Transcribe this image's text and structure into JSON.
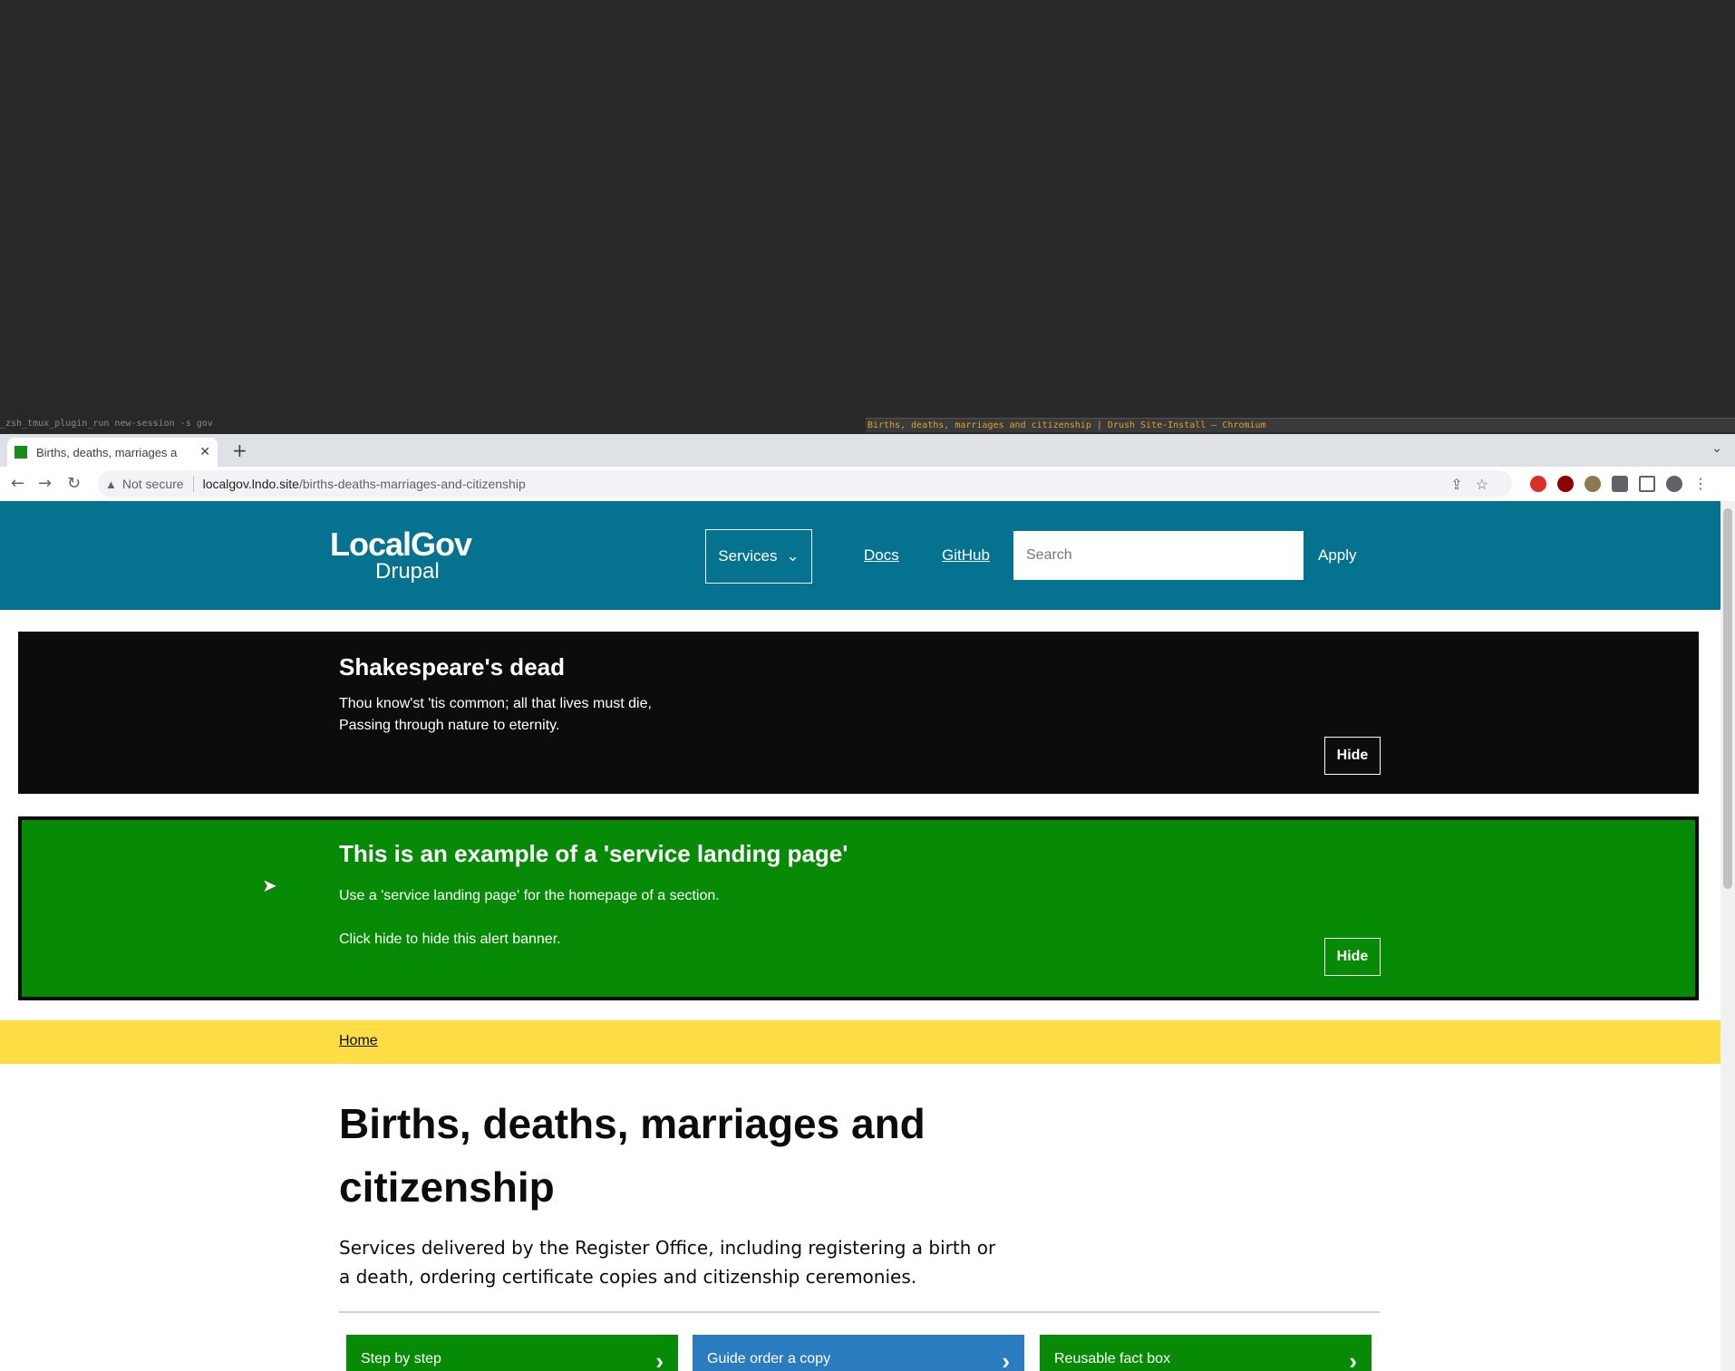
{
  "tmux": {
    "left_status": "_zsh_tmux_plugin_run new-session -s gov",
    "window_title": "Births, deaths, marriages and citizenship | Drush Site-Install – Chromium"
  },
  "browser": {
    "tab_title": "Births, deaths, marriages a",
    "security_label": "Not secure",
    "url_host": "localgov.lndo.site",
    "url_path": "/births-deaths-marriages-and-citizenship"
  },
  "header": {
    "logo_top": "LocalGov",
    "logo_bottom": "Drupal",
    "services_label": "Services",
    "docs_label": "Docs",
    "github_label": "GitHub",
    "search_placeholder": "Search",
    "apply_label": "Apply"
  },
  "alerts": [
    {
      "title": "Shakespeare's dead",
      "line1": "Thou know'st 'tis common; all that lives must die,",
      "line2": "Passing through nature to eternity.",
      "hide_label": "Hide",
      "color": "#0b0c0c"
    },
    {
      "title": "This is an example of a 'service landing page'",
      "line1": "Use a 'service landing page' for the homepage of a section.",
      "line2": "Click hide to hide this alert banner.",
      "hide_label": "Hide",
      "color": "#078b07"
    }
  ],
  "breadcrumb": {
    "home": "Home"
  },
  "main": {
    "title": "Births, deaths, marriages and citizenship",
    "summary": "Services delivered by the Register Office, including registering a birth or a death, ordering certificate copies and citizenship ceremonies."
  },
  "cards": [
    {
      "label": "Step by step",
      "color": "#078b07"
    },
    {
      "label": "Guide order a copy",
      "color": "#2b7bbf"
    },
    {
      "label": "Reusable fact box",
      "color": "#078b07"
    }
  ]
}
